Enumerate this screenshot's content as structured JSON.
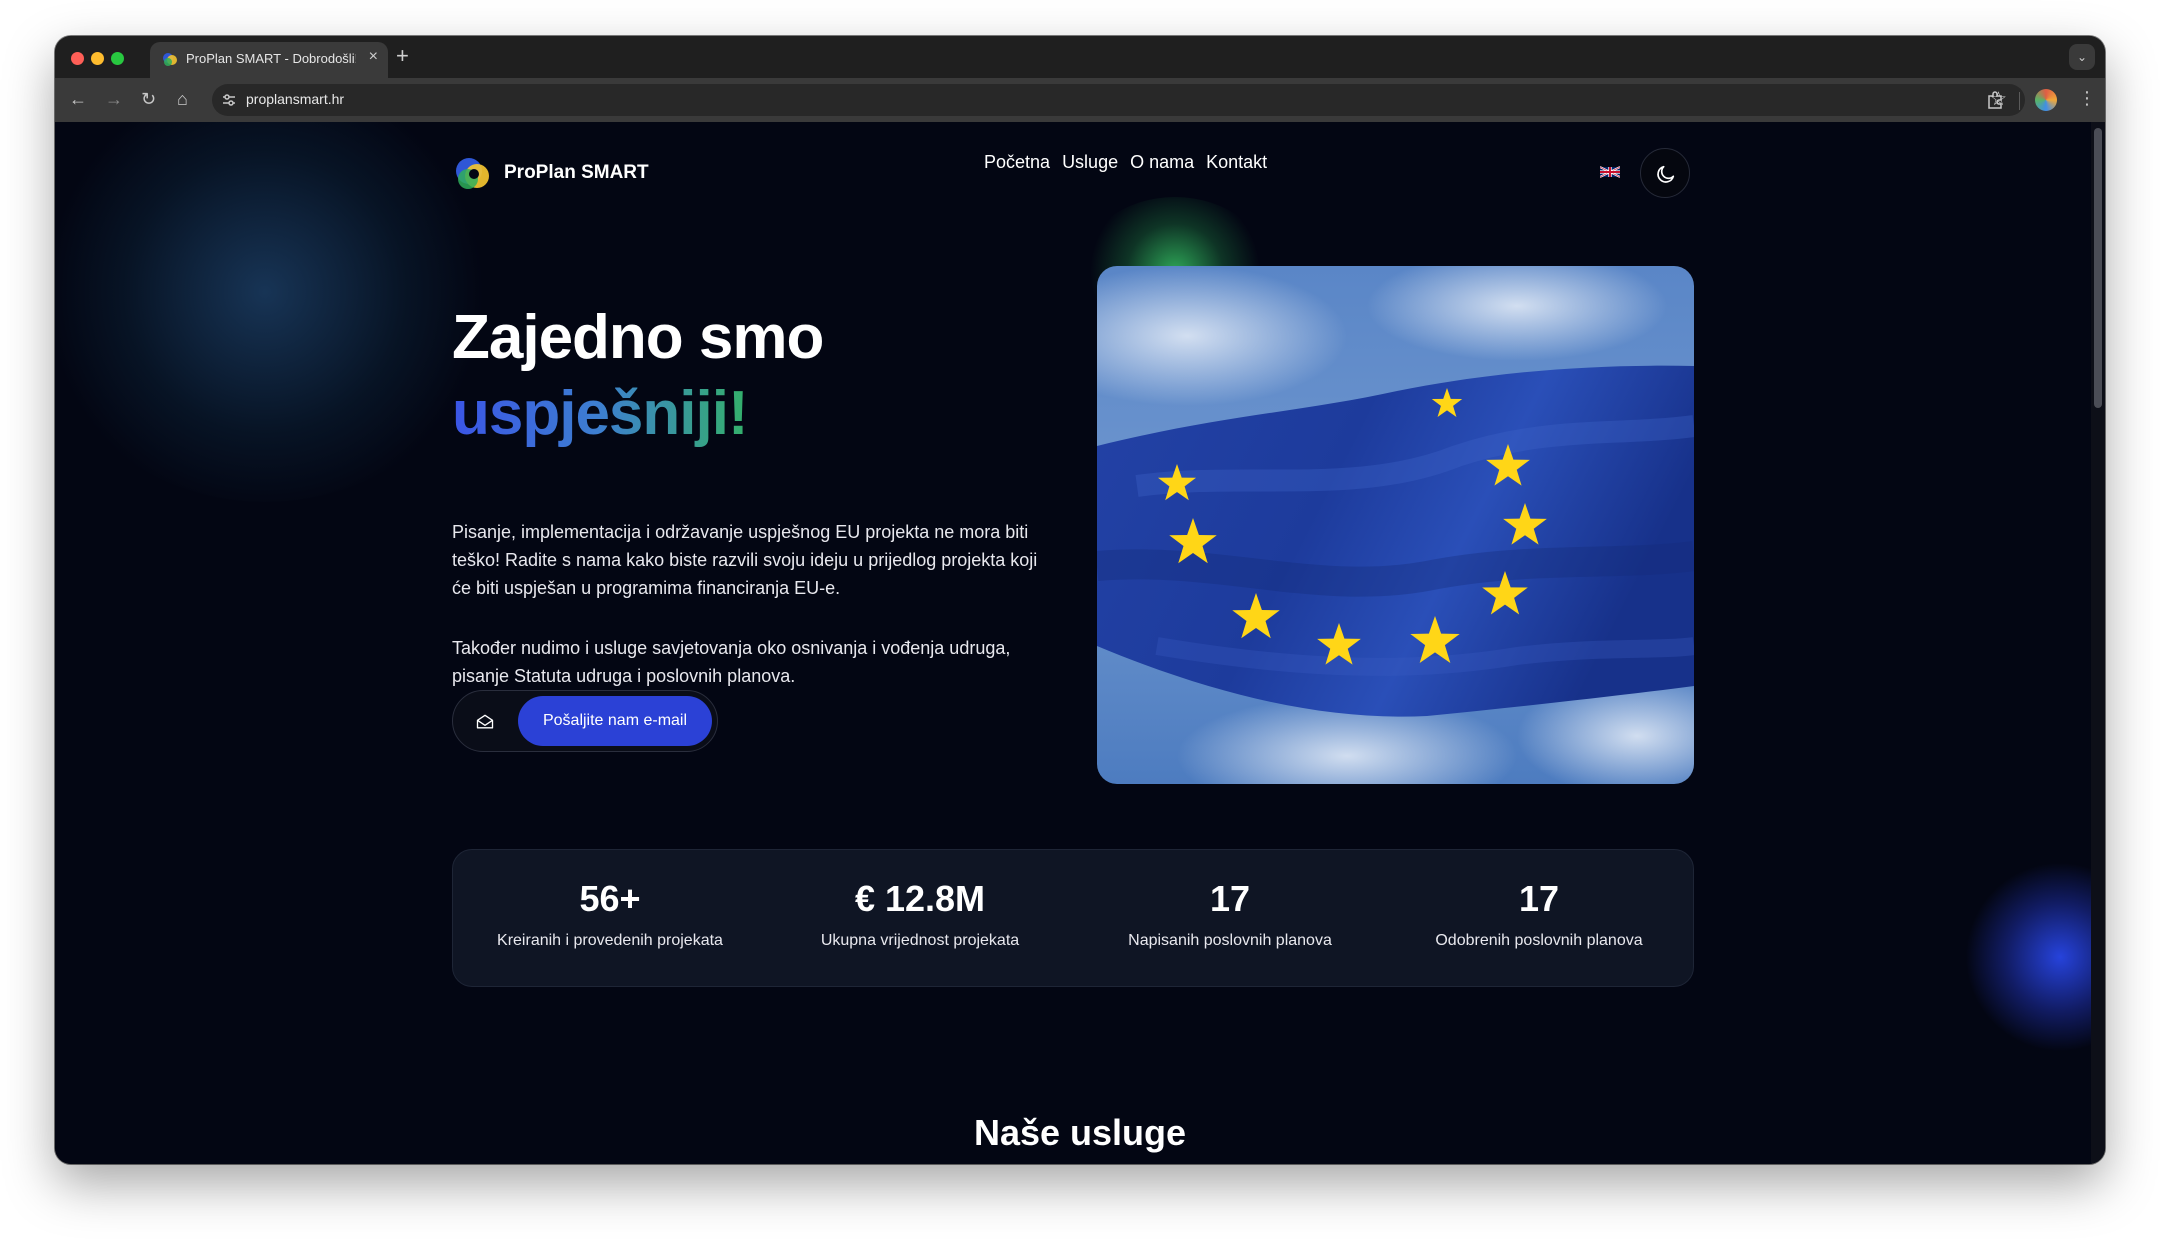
{
  "browser": {
    "tab_title": "ProPlan SMART - Dobrodošli!",
    "tab_close": "×",
    "new_tab": "+",
    "url": "proplansmart.hr",
    "nav": {
      "back": "←",
      "forward": "→",
      "reload": "↻",
      "home": "⌂"
    },
    "star": "☆",
    "menu": "⋮",
    "dropdown": "⌄"
  },
  "header": {
    "brand": "ProPlan SMART",
    "nav": [
      "Početna",
      "Usluge",
      "O nama",
      "Kontakt"
    ]
  },
  "hero": {
    "title": "Zajedno smo",
    "title_accent": "uspješniji!",
    "paragraph_1": "Pisanje, implementacija i održavanje uspješnog EU projekta ne mora biti teško! Radite s nama kako biste razvili svoju ideju u prijedlog projekta koji će biti uspješan u programima financiranja EU-e.",
    "paragraph_2": "Također nudimo i usluge savjetovanja oko osnivanja i vođenja udruga, pisanje Statuta udruga i poslovnih planova.",
    "cta_label": "Pošaljite nam e-mail"
  },
  "stats": [
    {
      "value": "56+",
      "label": "Kreiranih i provedenih projekata"
    },
    {
      "value": "€ 12.8M",
      "label": "Ukupna vrijednost projekata"
    },
    {
      "value": "17",
      "label": "Napisanih poslovnih planova"
    },
    {
      "value": "17",
      "label": "Odobrenih poslovnih planova"
    }
  ],
  "sections": {
    "services_title": "Naše usluge"
  },
  "colors": {
    "background": "#030613",
    "accent": "#2b41d6",
    "card": "#0f1524",
    "flag_blue": "#1f3fa6",
    "star": "#ffd617"
  }
}
